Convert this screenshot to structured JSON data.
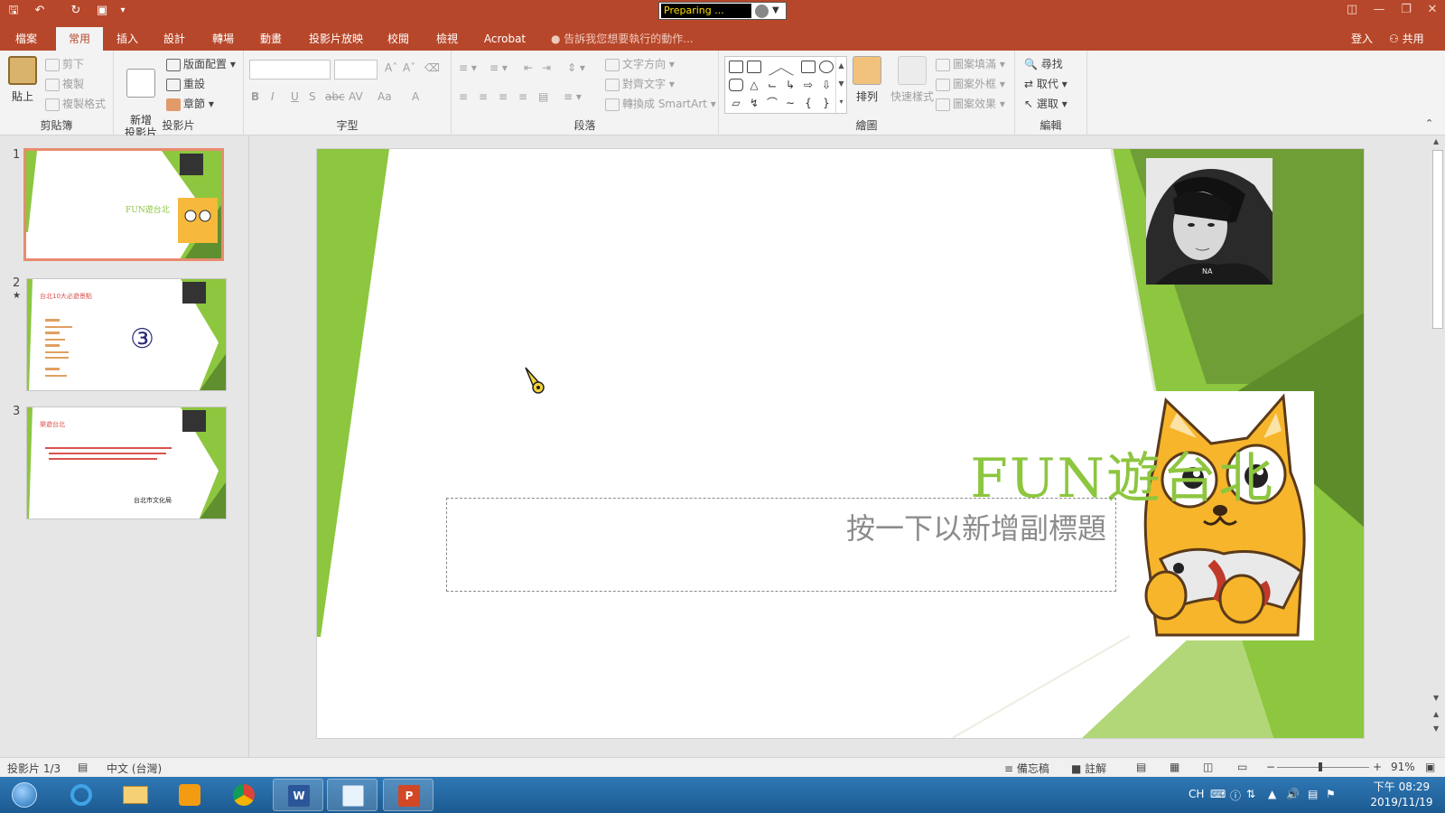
{
  "titlebar": {
    "recorder_status": "Preparing ...",
    "qat_icons": [
      "save-icon",
      "undo-icon",
      "redo-icon",
      "present-icon",
      "customize-icon"
    ]
  },
  "tabs": [
    {
      "label": "檔案"
    },
    {
      "label": "常用"
    },
    {
      "label": "插入"
    },
    {
      "label": "設計"
    },
    {
      "label": "轉場"
    },
    {
      "label": "動畫"
    },
    {
      "label": "投影片放映"
    },
    {
      "label": "校閱"
    },
    {
      "label": "檢視"
    },
    {
      "label": "Acrobat"
    }
  ],
  "tell_me": "告訴我您想要執行的動作...",
  "sign_in": "登入",
  "share": "共用",
  "ribbon": {
    "clipboard": {
      "label": "剪貼簿",
      "paste": "貼上",
      "cut": "剪下",
      "copy": "複製",
      "format_painter": "複製格式"
    },
    "slides": {
      "label": "投影片",
      "new_slide": "新增\n投影片",
      "layout": "版面配置",
      "reset": "重設",
      "section": "章節"
    },
    "font": {
      "label": "字型",
      "bold": "B",
      "italic": "I",
      "underline": "U",
      "shadow": "S",
      "strike": "abc",
      "spacing": "AV",
      "case": "Aa",
      "color": "A"
    },
    "paragraph": {
      "label": "段落",
      "text_direction": "文字方向",
      "align_text": "對齊文字",
      "convert_smartart": "轉換成 SmartArt"
    },
    "drawing": {
      "label": "繪圖",
      "arrange": "排列",
      "quick_styles": "快速樣式",
      "shape_fill": "圖案填滿",
      "shape_outline": "圖案外框",
      "shape_effects": "圖案效果"
    },
    "editing": {
      "label": "編輯",
      "find": "尋找",
      "replace": "取代",
      "select": "選取"
    }
  },
  "thumbnails": [
    {
      "num": "1",
      "title": "FUN遊台北"
    },
    {
      "num": "2",
      "title": "台北10大必遊景點",
      "circled": "③"
    },
    {
      "num": "3",
      "title": "樂遊台北",
      "footer": "台北市文化局"
    }
  ],
  "slide": {
    "title": "FUN遊台北",
    "subtitle_placeholder": "按一下以新增副標題"
  },
  "status": {
    "slide_count": "投影片 1/3",
    "language": "中文 (台灣)",
    "notes": "備忘稿",
    "comments": "註解",
    "zoom": "91%"
  },
  "taskbar": {
    "apps": [
      "ie-icon",
      "explorer-icon",
      "media-player-icon",
      "chrome-icon",
      "word-icon",
      "paint-icon",
      "powerpoint-icon"
    ],
    "lang": "CH",
    "time": "下午 08:29",
    "date": "2019/11/19"
  },
  "colors": {
    "accent": "#b7472a",
    "slide_green": "#8dc63f"
  }
}
